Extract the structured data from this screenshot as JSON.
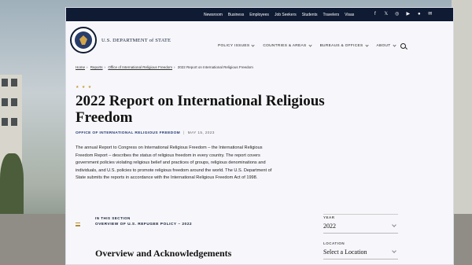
{
  "topbar": {
    "links": [
      "Newsroom",
      "Business",
      "Employees",
      "Job Seekers",
      "Students",
      "Travelers",
      "Visas"
    ],
    "social_icons": [
      "facebook-icon",
      "twitter-icon",
      "instagram-icon",
      "youtube-icon",
      "flickr-icon",
      "email-icon"
    ]
  },
  "header": {
    "brand": "U.S. DEPARTMENT of STATE",
    "nav": [
      "POLICY ISSUES",
      "COUNTRIES & AREAS",
      "BUREAUS & OFFICES",
      "ABOUT"
    ]
  },
  "breadcrumb": {
    "items": [
      "Home",
      "Reports",
      "Office of International Religious Freedom",
      "2022 Report on International Religious Freedom"
    ]
  },
  "page": {
    "stars": "★ ★ ★",
    "title": "2022 Report on International Religious Freedom",
    "office": "OFFICE OF INTERNATIONAL RELIGIOUS FREEDOM",
    "date": "MAY 15, 2023",
    "intro": "The annual Report to Congress on International Religious Freedom – the International Religious Freedom Report – describes the status of religious freedom in every country. The report covers government policies violating religious belief and practices of groups, religious denominations and individuals, and U.S. policies to promote religious freedom around the world. The U.S. Department of State submits the reports in accordance with the International Religious Freedom Act of 1998."
  },
  "section": {
    "label": "IN THIS SECTION",
    "value": "OVERVIEW OF U.S. REFUGEE POLICY – 2022",
    "heading": "Overview and Acknowledgements"
  },
  "filters": {
    "year_label": "YEAR",
    "year_value": "2022",
    "location_label": "LOCATION",
    "location_value": "Select a Location"
  }
}
